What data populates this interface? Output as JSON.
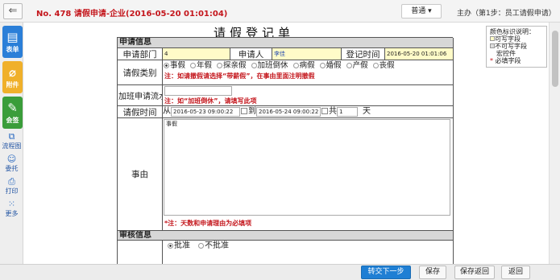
{
  "topbar": {
    "back_label": "⇐",
    "doc_title": "No. 478 请假申请-企业(2016-05-20 01:01:04)",
    "normal_label": "普通 ▾",
    "step_label": "主办（第1步：员工请假申请）"
  },
  "sidebar": {
    "items": [
      {
        "label": "表单",
        "icon": "form-icon"
      },
      {
        "label": "附件",
        "icon": "paperclip-icon"
      },
      {
        "label": "会签",
        "icon": "edit-icon"
      }
    ],
    "tools": [
      {
        "label": "流程图",
        "icon": "flowchart-icon"
      },
      {
        "label": "委托",
        "icon": "user-icon"
      },
      {
        "label": "打印",
        "icon": "printer-icon"
      },
      {
        "label": "更多",
        "icon": "grid-icon"
      }
    ]
  },
  "form": {
    "title": "请假登记单",
    "section_apply": "申请信息",
    "dept_label": "申请部门",
    "dept_value": "4",
    "applicant_label": "申请人",
    "applicant_value": "李佳",
    "reg_time_label": "登记时间",
    "reg_time_value": "2016-05-20 01:01:06",
    "type_label": "请假类别",
    "leave_types": [
      "事假",
      "年假",
      "探亲假",
      "加班倒休",
      "病假",
      "婚假",
      "产假",
      "丧假"
    ],
    "selected_type": "事假",
    "type_hint": "注：如请撤假请选择“带薪假”，在事由里面注明撤假",
    "overtime_label": "加班申请流水号",
    "overtime_hint": "注：如“加班倒休”，请填写此项",
    "time_label": "请假时间",
    "time_from": "从",
    "time_start": "2016-05-23 09:00:22",
    "time_to": "到",
    "time_end": "2016-05-24 09:00:22",
    "total_label": "共",
    "total_value": "1",
    "day_unit": "天",
    "reason_label": "事由",
    "reason_value": "事假",
    "required_hint": "*注：天数和申请理由为必填项",
    "section_review": "审核信息",
    "approve_options": [
      "批准",
      "不批准"
    ],
    "approve_selected": "批准"
  },
  "legend": {
    "title": "颜色标识说明：",
    "items": [
      "可写字段",
      "不可写字段",
      "宏控件",
      "必填字段"
    ]
  },
  "buttons": {
    "submit": "转交下一步",
    "save": "保存",
    "save_return": "保存返回",
    "return": "返回"
  },
  "colors": {
    "accent": "#1f7fd4",
    "required": "#c4161c",
    "editable": "#fffbc8"
  }
}
